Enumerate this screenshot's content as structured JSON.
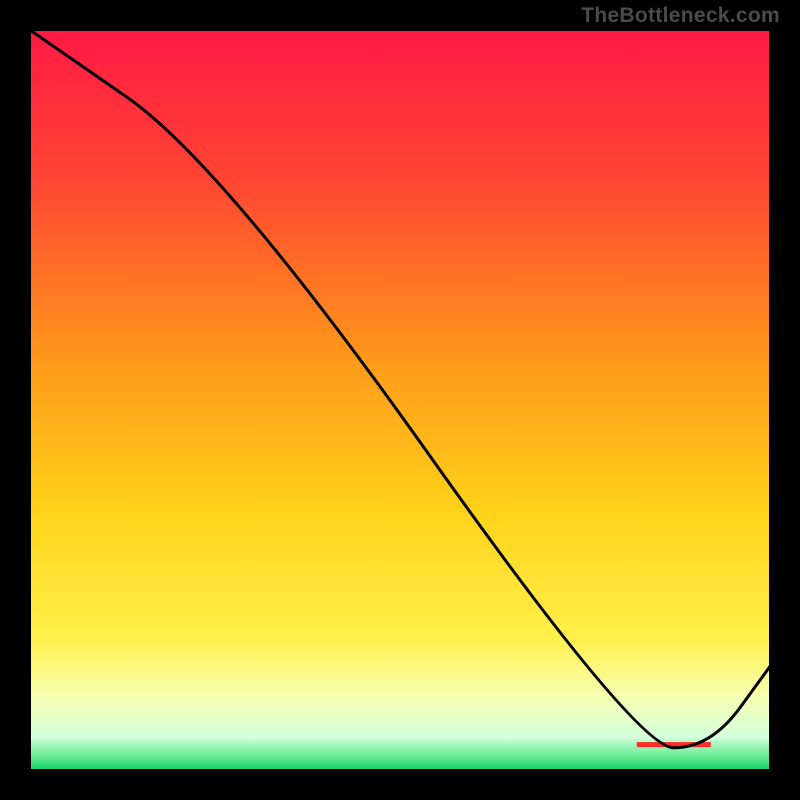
{
  "watermark": "TheBottleneck.com",
  "chart_data": {
    "type": "line",
    "title": "",
    "xlabel": "",
    "ylabel": "",
    "xlim": [
      0,
      100
    ],
    "ylim": [
      0,
      100
    ],
    "x": [
      0,
      26,
      82,
      92,
      100
    ],
    "values": [
      100,
      82,
      3,
      3,
      14
    ],
    "series_label": "",
    "gradient_stops": [
      {
        "offset": 0.0,
        "color": "#ff1a45"
      },
      {
        "offset": 0.2,
        "color": "#ff4433"
      },
      {
        "offset": 0.45,
        "color": "#ff9a1a"
      },
      {
        "offset": 0.65,
        "color": "#ffd21a"
      },
      {
        "offset": 0.82,
        "color": "#fff04a"
      },
      {
        "offset": 0.9,
        "color": "#f6ffb0"
      },
      {
        "offset": 0.955,
        "color": "#d6ffdc"
      },
      {
        "offset": 0.985,
        "color": "#57e889"
      },
      {
        "offset": 1.0,
        "color": "#13cf6a"
      }
    ],
    "red_strip_y_frac": 0.965
  }
}
